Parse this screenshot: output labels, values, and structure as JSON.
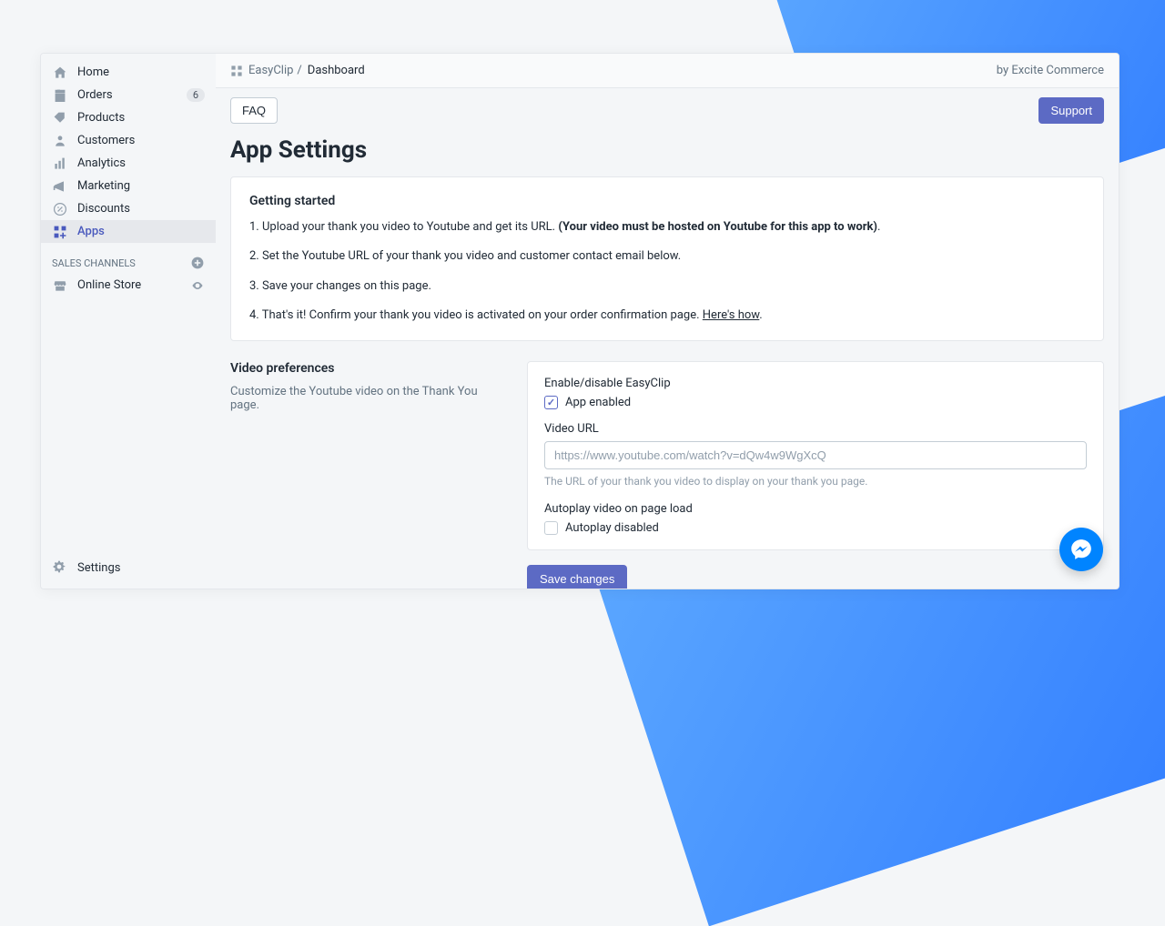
{
  "sidebar": {
    "items": [
      {
        "label": "Home",
        "icon": "home-icon"
      },
      {
        "label": "Orders",
        "icon": "orders-icon",
        "badge": "6"
      },
      {
        "label": "Products",
        "icon": "products-icon"
      },
      {
        "label": "Customers",
        "icon": "customers-icon"
      },
      {
        "label": "Analytics",
        "icon": "analytics-icon"
      },
      {
        "label": "Marketing",
        "icon": "marketing-icon"
      },
      {
        "label": "Discounts",
        "icon": "discounts-icon"
      },
      {
        "label": "Apps",
        "icon": "apps-icon",
        "active": true
      }
    ],
    "sales_channels_label": "SALES CHANNELS",
    "channels": [
      {
        "label": "Online Store",
        "icon": "store-icon"
      }
    ],
    "settings_label": "Settings"
  },
  "breadcrumb": {
    "app": "EasyClip",
    "current": "Dashboard",
    "by_vendor": "by Excite Commerce"
  },
  "toolbar": {
    "faq_label": "FAQ",
    "support_label": "Support"
  },
  "page": {
    "title": "App Settings"
  },
  "getting_started": {
    "heading": "Getting started",
    "step1_prefix": "1. Upload your thank you video to Youtube and get its URL. ",
    "step1_bold": "(Your video must be hosted on Youtube for this app to work)",
    "step1_suffix": ".",
    "step2": "2. Set the Youtube URL of your thank you video and customer contact email below.",
    "step3": "3. Save your changes on this page.",
    "step4_prefix": "4. That's it! Confirm your thank you video is activated on your order confirmation page. ",
    "step4_link": "Here's how",
    "step4_suffix": "."
  },
  "video_prefs": {
    "heading": "Video preferences",
    "sub": "Customize the Youtube video on the Thank You page.",
    "enable_label": "Enable/disable EasyClip",
    "app_enabled_label": "App enabled",
    "app_enabled_checked": true,
    "video_url_label": "Video URL",
    "video_url_placeholder": "https://www.youtube.com/watch?v=dQw4w9WgXcQ",
    "video_url_helper": "The URL of your thank you video to display on your thank you page.",
    "autoplay_heading": "Autoplay video on page load",
    "autoplay_label": "Autoplay disabled",
    "autoplay_checked": false,
    "save_label": "Save changes"
  }
}
